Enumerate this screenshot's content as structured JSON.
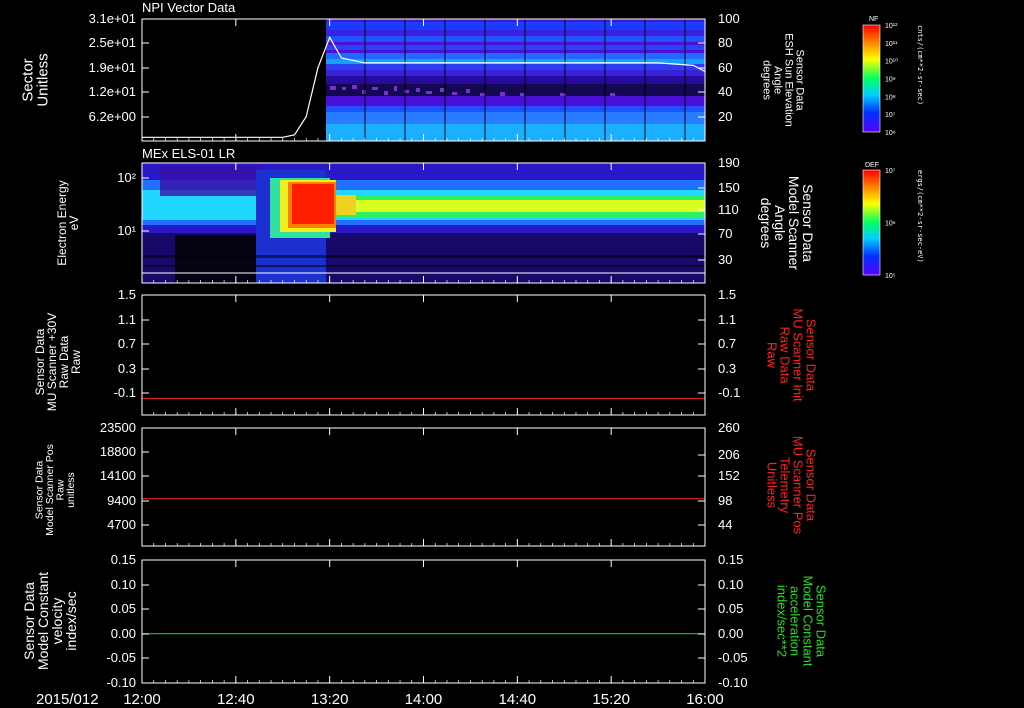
{
  "panels": [
    {
      "title": "NPI Vector Data",
      "left_label": [
        "Sector",
        "Unitless"
      ],
      "right_label": [
        "Sensor Data",
        "ESH Sun Elevation",
        "Angle",
        "degrees"
      ],
      "right_label_color": "#ffffff",
      "left_ticks": [
        "3.1e+01",
        "2.5e+01",
        "1.9e+01",
        "1.2e+01",
        "6.2e+00"
      ],
      "right_ticks": [
        "100",
        "80",
        "60",
        "40",
        "20"
      ]
    },
    {
      "title": "MEx ELS-01 LR",
      "left_label": [
        "Electron Energy",
        "eV"
      ],
      "right_label": [
        "Sensor Data",
        "Model Scanner",
        "Angle",
        "degrees"
      ],
      "right_label_color": "#ffffff",
      "left_ticks": [
        "10²",
        "10¹"
      ],
      "right_ticks": [
        "190",
        "150",
        "110",
        "70",
        "30"
      ]
    },
    {
      "title": "",
      "left_label": [
        "Sensor Data",
        "MU Scanner +30V",
        "Raw Data",
        "Raw"
      ],
      "right_label": [
        "Sensor Data",
        "MU Scanner Init",
        "Raw Data",
        "Raw"
      ],
      "right_label_color": "#ff2020",
      "left_ticks": [
        "1.5",
        "1.1",
        "0.7",
        "0.3",
        "-0.1"
      ],
      "right_ticks": [
        "1.5",
        "1.1",
        "0.7",
        "0.3",
        "-0.1"
      ]
    },
    {
      "title": "",
      "left_label": [
        "Sensor Data",
        "Model Scanner Pos",
        "Raw",
        "unitless"
      ],
      "right_label": [
        "Sensor Data",
        "MU Scanner Pos",
        "Telemetry",
        "Unitless"
      ],
      "right_label_color": "#ff2020",
      "left_ticks": [
        "23500",
        "18800",
        "14100",
        "9400",
        "4700"
      ],
      "right_ticks": [
        "260",
        "206",
        "152",
        "98",
        "44"
      ]
    },
    {
      "title": "",
      "left_label": [
        "Sensor Data",
        "Model Constant",
        "velocity",
        "index/sec"
      ],
      "right_label": [
        "Sensor Data",
        "Model Constant",
        "acceleration",
        "index/sec**2"
      ],
      "right_label_color": "#20e020",
      "left_ticks": [
        "0.15",
        "0.10",
        "0.05",
        "0.00",
        "-0.05",
        "-0.10"
      ],
      "right_ticks": [
        "0.15",
        "0.10",
        "0.05",
        "0.00",
        "-0.05",
        "-0.10"
      ]
    }
  ],
  "colorbars": [
    {
      "label": "NF",
      "units": "cnts/(cm**2-sr-sec)",
      "ticks": [
        "10¹²",
        "10¹¹",
        "10¹⁰",
        "10⁹",
        "10⁸",
        "10⁷",
        "10⁶"
      ]
    },
    {
      "label": "DEF",
      "units": "ergs/(cm**2-sr-sec-eV)",
      "ticks": [
        "10⁷",
        "10⁶",
        "10⁵"
      ]
    }
  ],
  "time_axis": {
    "date": "2015/012",
    "ticks": [
      "12:00",
      "12:40",
      "13:20",
      "14:00",
      "14:40",
      "15:20",
      "16:00"
    ]
  },
  "chart_data": [
    {
      "type": "heatmap",
      "title": "NPI Vector Data",
      "ylabel": "Sector Unitless",
      "overlay_line": {
        "name": "ESH Sun Elevation Angle",
        "ylim": [
          0,
          100
        ],
        "x": [
          "12:00",
          "12:40",
          "13:00",
          "13:05",
          "13:10",
          "13:15",
          "13:20",
          "13:25",
          "13:35",
          "15:40",
          "15:55",
          "16:00"
        ],
        "y": [
          3,
          3,
          3,
          5,
          20,
          60,
          85,
          68,
          64,
          64,
          62,
          57
        ]
      },
      "data_start": "13:15"
    },
    {
      "type": "heatmap",
      "title": "MEx ELS-01 LR",
      "ylabel": "Electron Energy eV",
      "overlay_line": {
        "name": "Model Scanner Angle",
        "ylim": [
          10,
          190
        ],
        "x": [
          "12:00",
          "16:00"
        ],
        "y": [
          15,
          15
        ]
      },
      "hot_region": {
        "x": [
          "13:00",
          "13:25"
        ],
        "energy_eV": [
          20,
          110
        ]
      }
    },
    {
      "type": "line",
      "ylim": [
        -0.3,
        1.5
      ],
      "series": [
        {
          "x": [
            "12:00",
            "16:00"
          ],
          "values": [
            -0.05,
            -0.05
          ],
          "color": "#ff2020"
        }
      ]
    },
    {
      "type": "line",
      "ylim": [
        0,
        23500
      ],
      "series": [
        {
          "x": [
            "12:00",
            "16:00"
          ],
          "values": [
            9400,
            9400
          ],
          "color": "#ff2020"
        }
      ]
    },
    {
      "type": "line",
      "ylim": [
        -0.1,
        0.15
      ],
      "series": [
        {
          "x": [
            "12:00",
            "16:00"
          ],
          "values": [
            0.0,
            0.0
          ],
          "color": "#20e020"
        }
      ]
    }
  ]
}
